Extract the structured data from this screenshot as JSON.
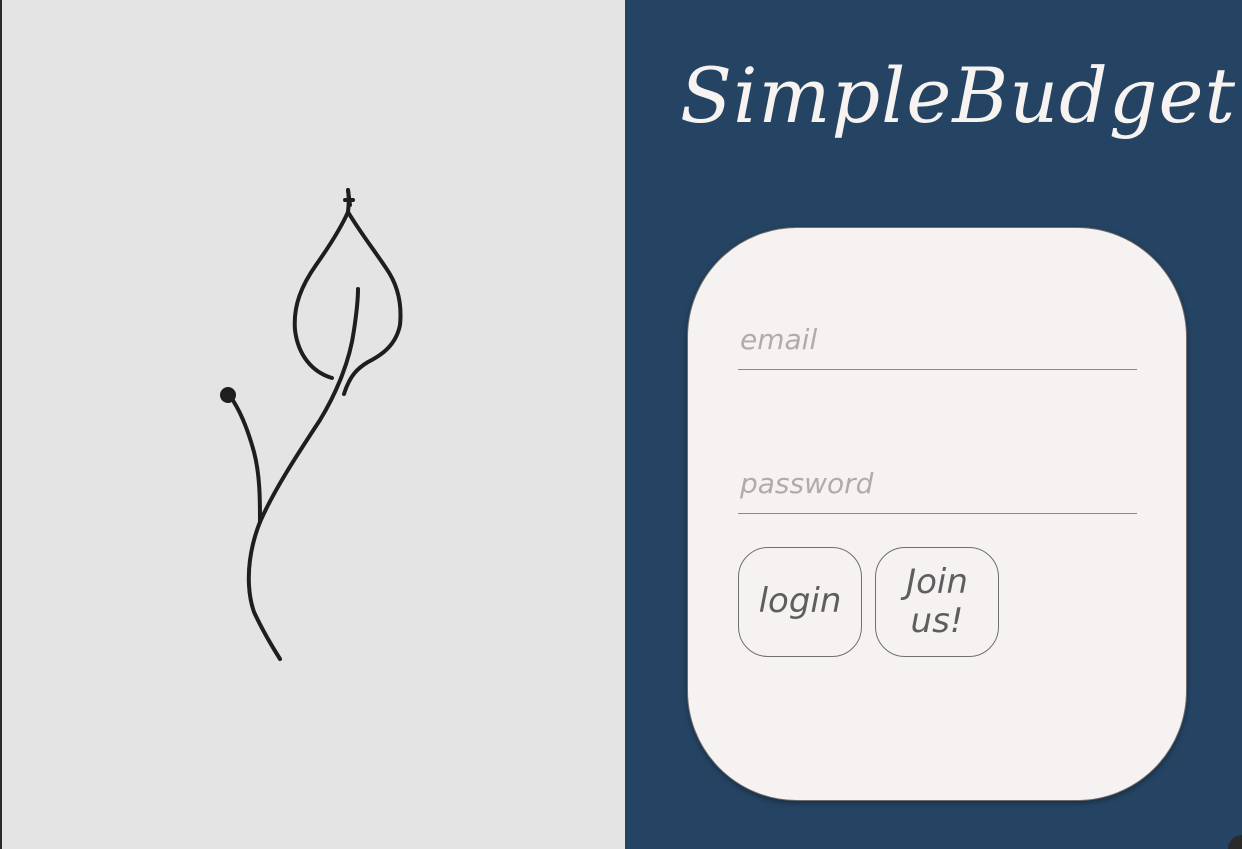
{
  "app": {
    "title": "SimpleBudget"
  },
  "login_form": {
    "email_placeholder": "email",
    "email_value": "",
    "password_placeholder": "password",
    "password_value": "",
    "login_label": "login",
    "join_label": "Join us!"
  },
  "illustration": {
    "icon": "plant-leaf-icon"
  },
  "colors": {
    "left_background": "#e4e4e4",
    "right_background": "#254463",
    "card_background": "#f7f2f2",
    "title_color": "#f7f3f1",
    "line_art": "#1e1e1e"
  }
}
